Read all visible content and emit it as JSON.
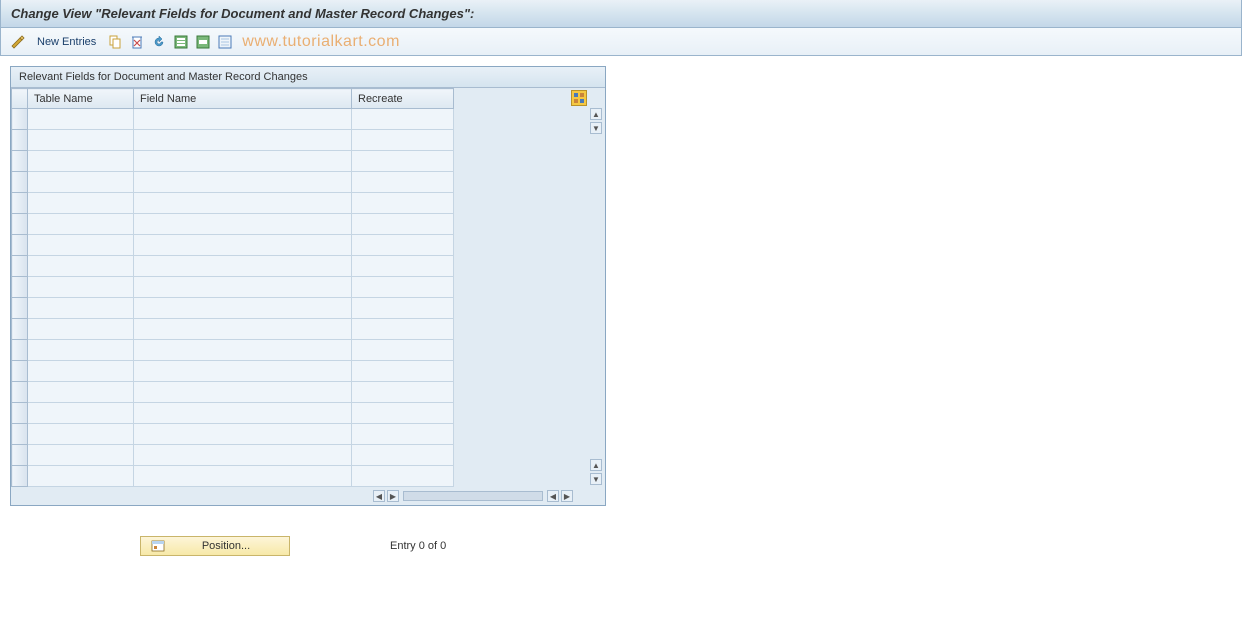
{
  "header": {
    "title": "Change View \"Relevant Fields for Document and Master Record Changes\":"
  },
  "toolbar": {
    "new_entries_label": "New Entries"
  },
  "watermark": "www.tutorialkart.com",
  "panel": {
    "title": "Relevant Fields for Document and Master Record Changes"
  },
  "table": {
    "columns": {
      "table_name": "Table Name",
      "field_name": "Field Name",
      "recreate": "Recreate"
    },
    "rows": [
      {
        "table_name": "",
        "field_name": "",
        "recreate": ""
      },
      {
        "table_name": "",
        "field_name": "",
        "recreate": ""
      },
      {
        "table_name": "",
        "field_name": "",
        "recreate": ""
      },
      {
        "table_name": "",
        "field_name": "",
        "recreate": ""
      },
      {
        "table_name": "",
        "field_name": "",
        "recreate": ""
      },
      {
        "table_name": "",
        "field_name": "",
        "recreate": ""
      },
      {
        "table_name": "",
        "field_name": "",
        "recreate": ""
      },
      {
        "table_name": "",
        "field_name": "",
        "recreate": ""
      },
      {
        "table_name": "",
        "field_name": "",
        "recreate": ""
      },
      {
        "table_name": "",
        "field_name": "",
        "recreate": ""
      },
      {
        "table_name": "",
        "field_name": "",
        "recreate": ""
      },
      {
        "table_name": "",
        "field_name": "",
        "recreate": ""
      },
      {
        "table_name": "",
        "field_name": "",
        "recreate": ""
      },
      {
        "table_name": "",
        "field_name": "",
        "recreate": ""
      },
      {
        "table_name": "",
        "field_name": "",
        "recreate": ""
      },
      {
        "table_name": "",
        "field_name": "",
        "recreate": ""
      },
      {
        "table_name": "",
        "field_name": "",
        "recreate": ""
      },
      {
        "table_name": "",
        "field_name": "",
        "recreate": ""
      }
    ]
  },
  "footer": {
    "position_label": "Position...",
    "entry_text": "Entry 0 of 0"
  }
}
